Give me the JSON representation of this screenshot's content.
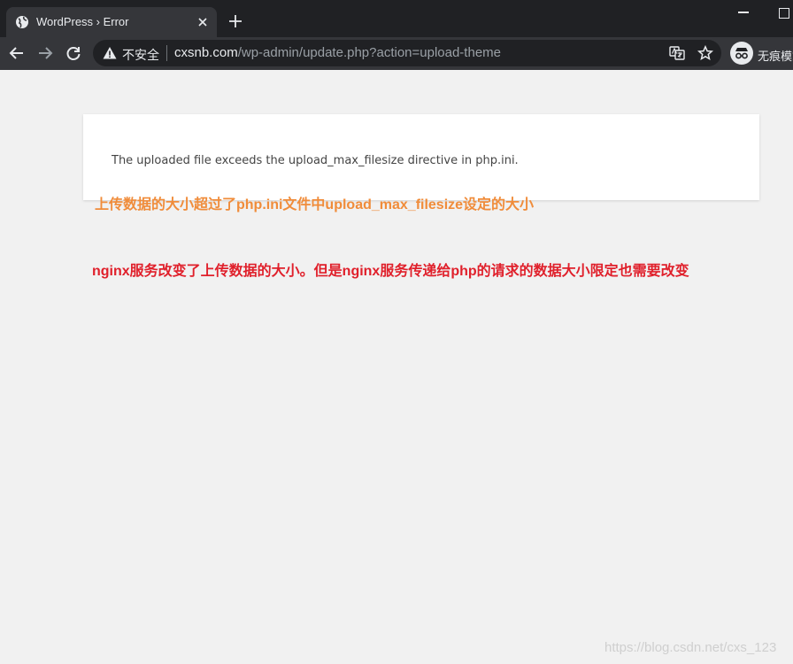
{
  "browser": {
    "tab_title": "WordPress › Error",
    "omnibox": {
      "security_label": "不安全",
      "url_host": "cxsnb.com",
      "url_path": "/wp-admin/update.php?action=upload-theme"
    },
    "profile_label": "无痕模式",
    "icons": {
      "tab_favicon": "globe-icon",
      "tab_close": "close-icon",
      "new_tab": "plus-icon",
      "back": "arrow-left-icon",
      "forward": "arrow-right-icon",
      "reload": "reload-icon",
      "security": "warning-icon",
      "translate": "translate-icon",
      "bookmark": "star-icon",
      "profile": "incognito-icon"
    }
  },
  "page": {
    "error_message": "The uploaded file exceeds the upload_max_filesize directive in php.ini."
  },
  "annotations": {
    "note1": "上传数据的大小超过了php.ini文件中upload_max_filesize设定的大小",
    "note2": "nginx服务改变了上传数据的大小。但是nginx服务传递给php的请求的数据大小限定也需要改变",
    "note1_color": "#f08c3a",
    "note2_color": "#e0202b"
  },
  "watermark": "https://blog.csdn.net/cxs_123"
}
